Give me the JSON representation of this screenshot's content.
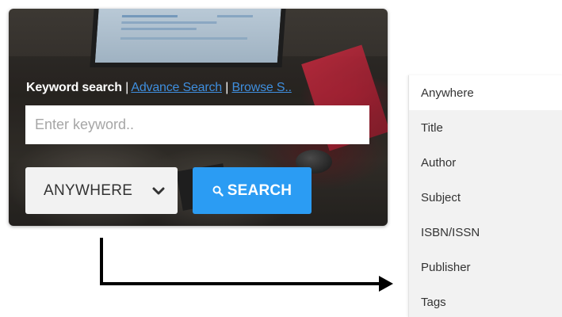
{
  "search_panel": {
    "links": {
      "keyword": "Keyword search",
      "separator": "|",
      "advance": "Advance Search",
      "browse": "Browse S.."
    },
    "keyword_input": {
      "value": "",
      "placeholder": "Enter keyword.."
    },
    "scope_select": {
      "selected": "ANYWHERE",
      "icon": "chevron-down-icon"
    },
    "search_button": {
      "label": "SEARCH",
      "icon": "search-icon"
    }
  },
  "dropdown": {
    "options": [
      "Anywhere",
      "Title",
      "Author",
      "Subject",
      "ISBN/ISSN",
      "Publisher",
      "Tags"
    ],
    "selected_index": 0
  },
  "colors": {
    "accent": "#2b9cf3",
    "link": "#3f8ede",
    "select_bg": "#f2f2f2",
    "option_bg": "#f2f2f2"
  }
}
